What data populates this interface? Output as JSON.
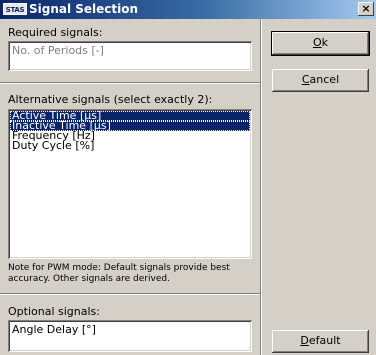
{
  "window": {
    "icon_text": "STAS",
    "title": "Signal Selection",
    "close_glyph": "×"
  },
  "required": {
    "label": "Required signals:",
    "value": "No. of Periods [-]"
  },
  "alternative": {
    "label": "Alternative signals (select exactly 2):",
    "items": [
      {
        "label": "Active Time [µs]",
        "selected": true
      },
      {
        "label": "Inactive Time [µs]",
        "selected": true
      },
      {
        "label": "Frequency [Hz]",
        "selected": false
      },
      {
        "label": "Duty Cycle [%]",
        "selected": false
      }
    ]
  },
  "note": {
    "line1": "Note for PWM mode: Default signals provide best",
    "line2": "accuracy. Other signals are derived."
  },
  "optional": {
    "label": "Optional signals:",
    "value": "Angle Delay [°]"
  },
  "buttons": {
    "ok": {
      "mnemonic": "O",
      "rest": "k"
    },
    "cancel": {
      "mnemonic": "C",
      "rest": "ancel"
    },
    "default": {
      "mnemonic": "D",
      "rest": "efault"
    }
  }
}
